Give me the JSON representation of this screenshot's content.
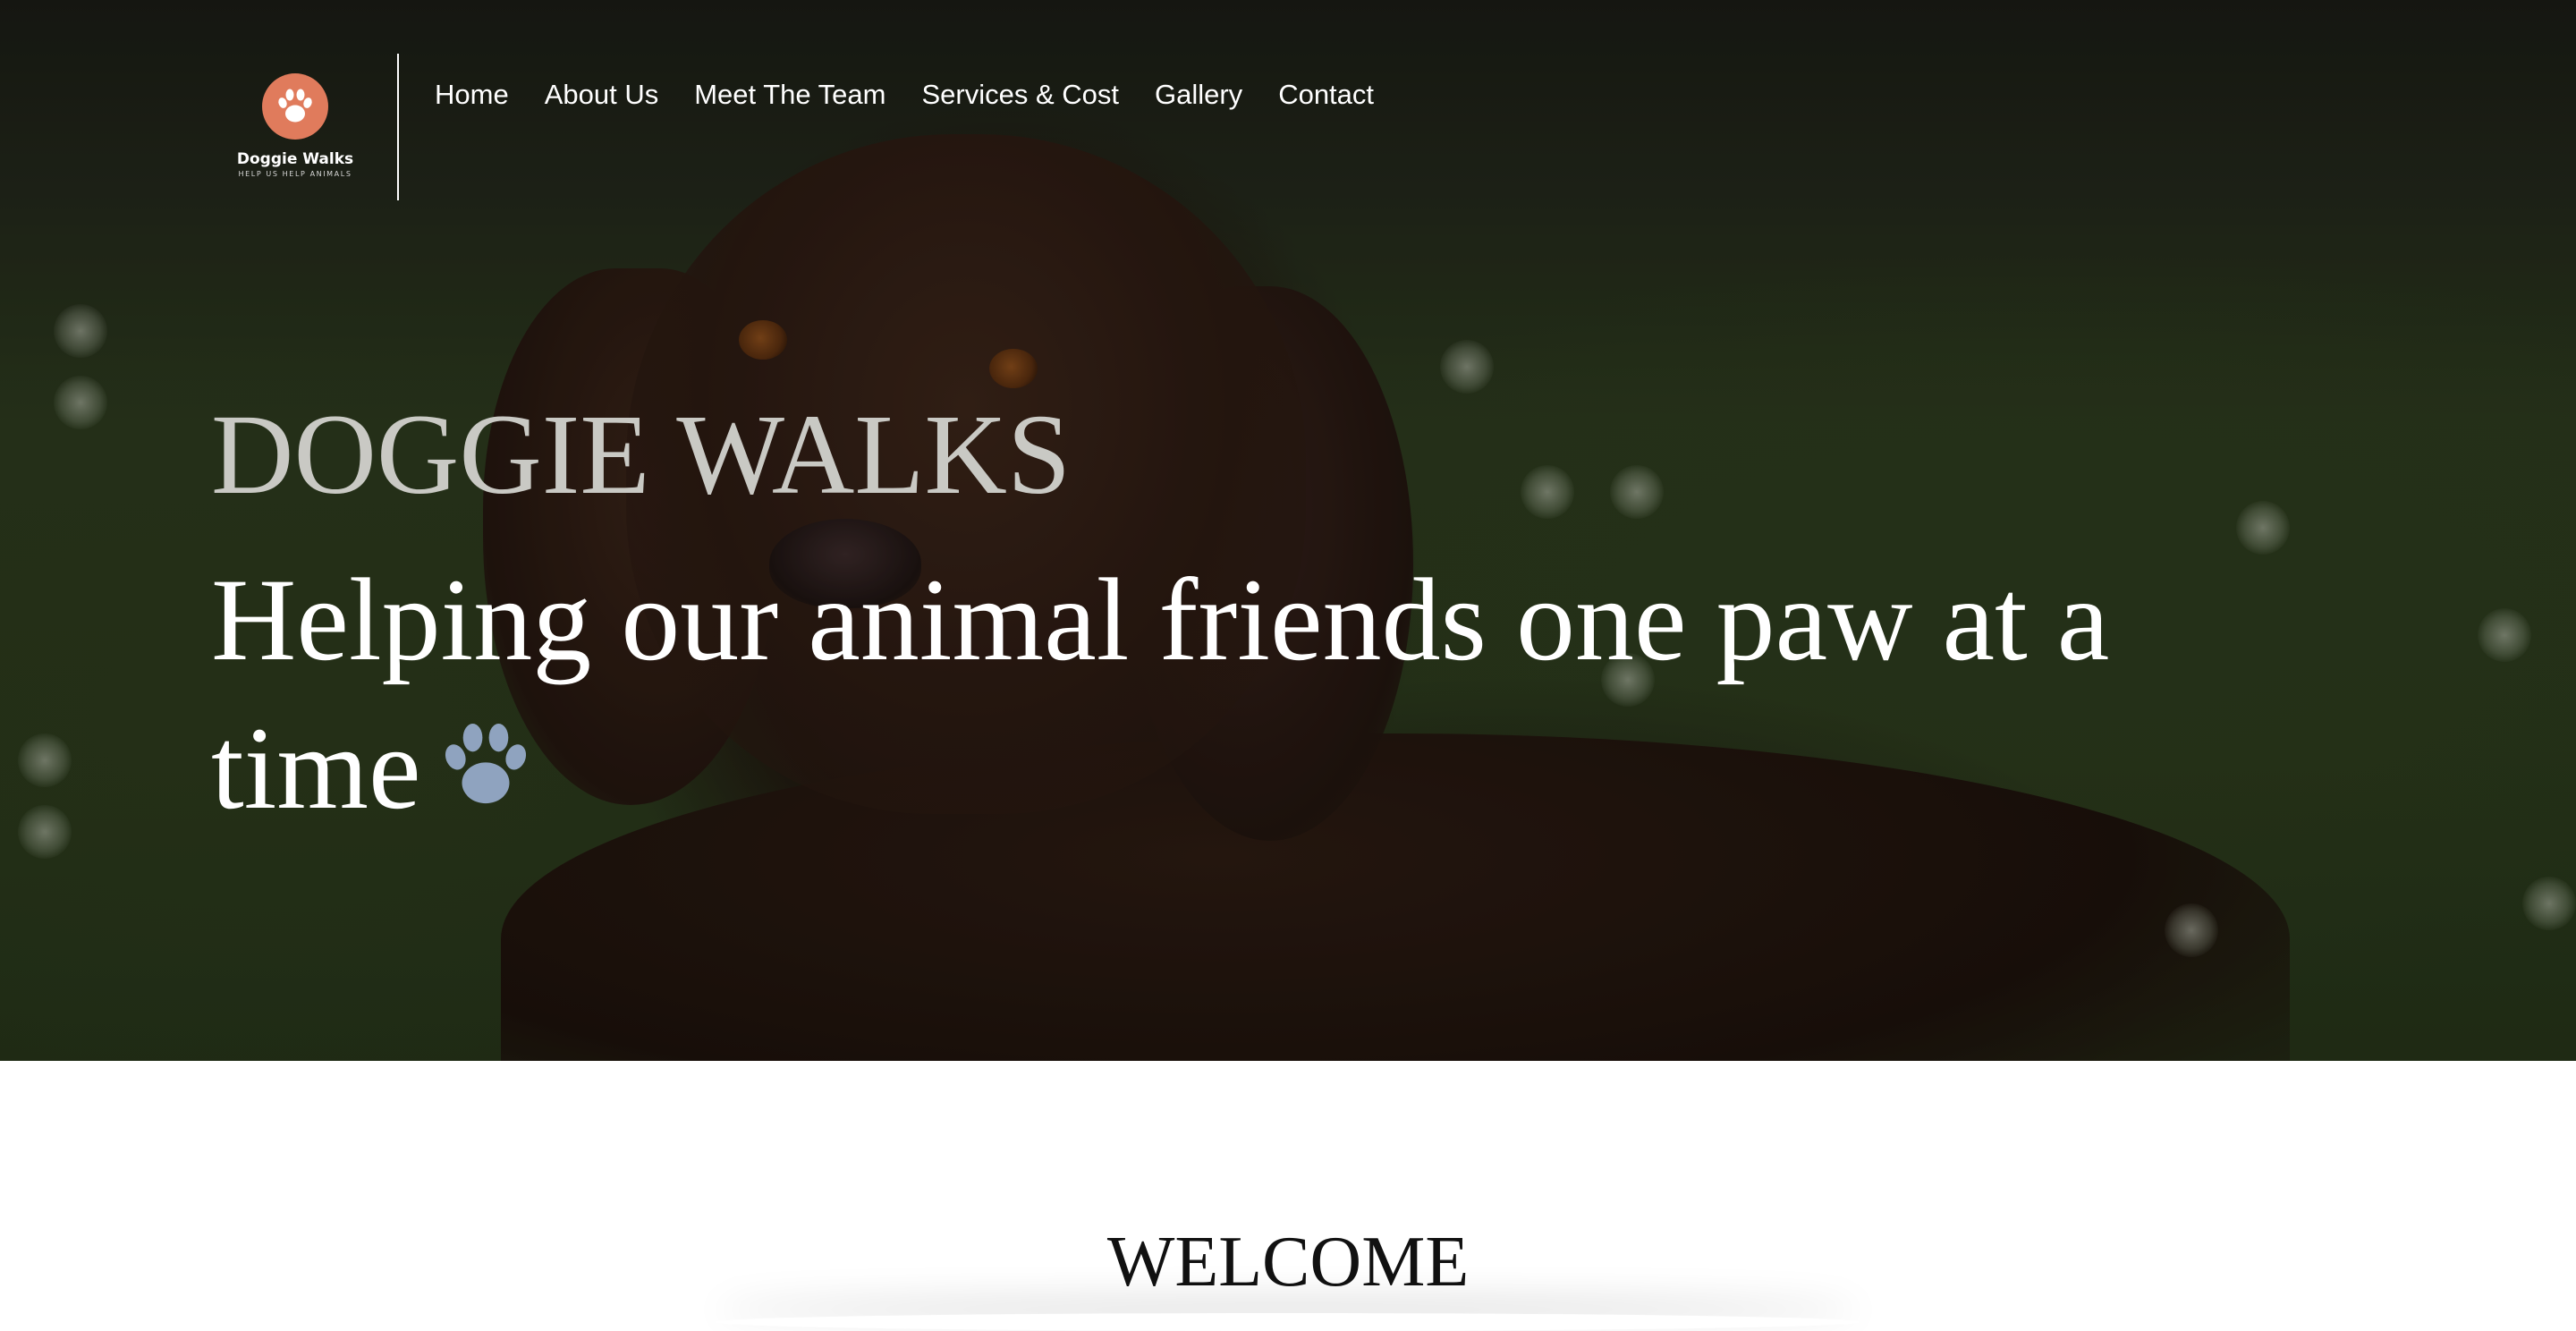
{
  "logo": {
    "name": "Doggie Walks",
    "tagline": "HELP US HELP ANIMALS",
    "icon": "paw-icon",
    "color": "#e07b5c"
  },
  "nav": {
    "items": [
      {
        "label": "Home"
      },
      {
        "label": "About Us"
      },
      {
        "label": "Meet The Team"
      },
      {
        "label": "Services & Cost"
      },
      {
        "label": "Gallery"
      },
      {
        "label": "Contact"
      }
    ]
  },
  "hero": {
    "brand": "DOGGIE WALKS",
    "tagline": "Helping our animal friends one paw at a time",
    "tagline_icon": "paw-icon",
    "tagline_icon_color": "#8fa3bf"
  },
  "welcome": {
    "title": "WELCOME"
  }
}
